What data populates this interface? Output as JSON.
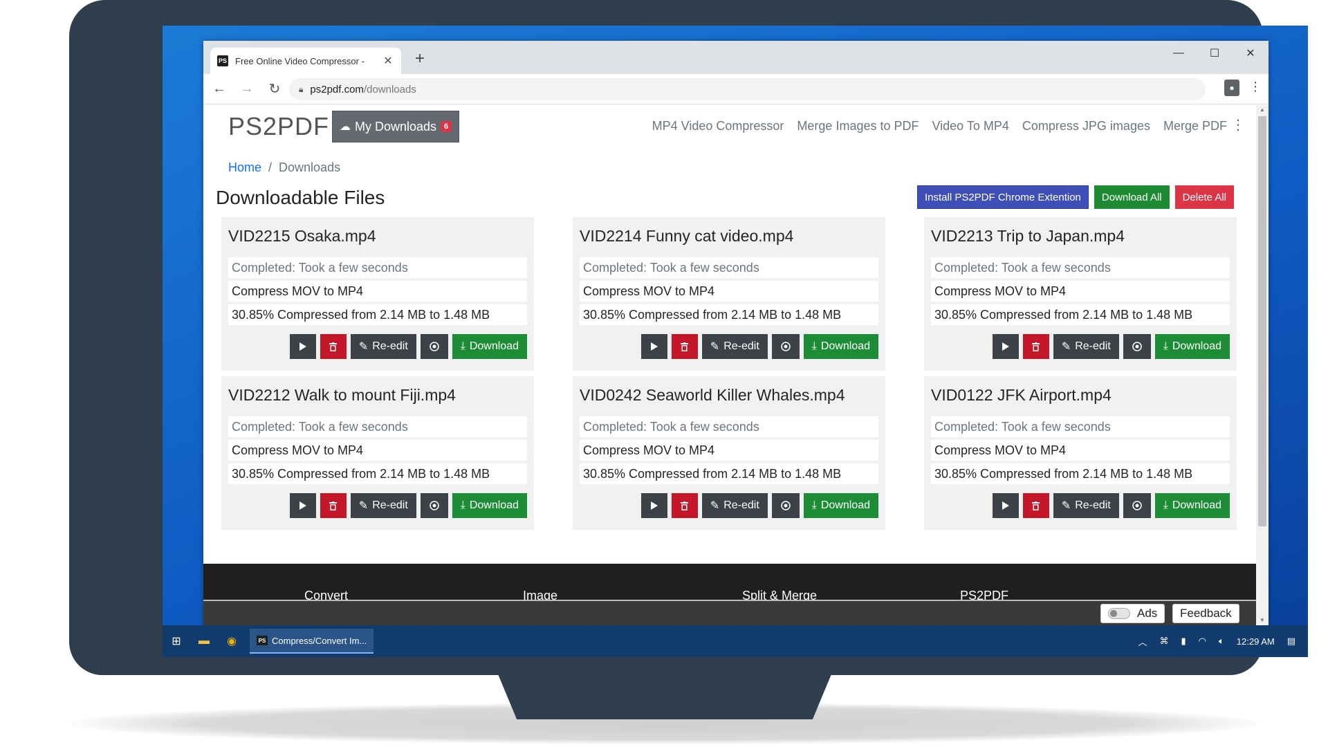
{
  "browser": {
    "tab_title": "Free Online Video Compressor - ",
    "favicon_text": "PS",
    "new_tab": "+",
    "url_host": "ps2pdf.com",
    "url_path": "/downloads"
  },
  "site": {
    "logo": "PS2PDF",
    "my_downloads": "My Downloads",
    "downloads_count": "6",
    "nav_links": [
      "MP4 Video Compressor",
      "Merge Images to PDF",
      "Video To MP4",
      "Compress JPG images",
      "Merge PDF"
    ]
  },
  "breadcrumb": {
    "home": "Home",
    "separator": "/",
    "current": "Downloads"
  },
  "heading": "Downloadable Files",
  "actions": {
    "install": "Install PS2PDF Chrome Extention",
    "download_all": "Download All",
    "delete_all": "Delete All"
  },
  "card_buttons": {
    "reedit": "Re-edit",
    "download": "Download"
  },
  "files": [
    {
      "name": "VID2215 Osaka.mp4",
      "status": "Completed: Took a few seconds",
      "task": "Compress MOV to MP4",
      "result": "30.85% Compressed from 2.14 MB to 1.48 MB"
    },
    {
      "name": "VID2214 Funny cat video.mp4",
      "status": "Completed: Took a few seconds",
      "task": "Compress MOV to MP4",
      "result": "30.85% Compressed from 2.14 MB to 1.48 MB"
    },
    {
      "name": "VID2213 Trip to Japan.mp4",
      "status": "Completed: Took a few seconds",
      "task": "Compress MOV to MP4",
      "result": "30.85% Compressed from 2.14 MB to 1.48 MB"
    },
    {
      "name": "VID2212 Walk to mount Fiji.mp4",
      "status": "Completed: Took a few seconds",
      "task": "Compress MOV to MP4",
      "result": "30.85% Compressed from 2.14 MB to 1.48 MB"
    },
    {
      "name": "VID0242 Seaworld Killer Whales.mp4",
      "status": "Completed: Took a few seconds",
      "task": "Compress MOV to MP4",
      "result": "30.85% Compressed from 2.14 MB to 1.48 MB"
    },
    {
      "name": "VID0122 JFK Airport.mp4",
      "status": "Completed: Took a few seconds",
      "task": "Compress MOV to MP4",
      "result": "30.85% Compressed from 2.14 MB to 1.48 MB"
    }
  ],
  "footer": {
    "links": [
      "Convert",
      "Image",
      "Split & Merge",
      "PS2PDF"
    ],
    "ads_label": "Ads",
    "feedback_label": "Feedback"
  },
  "taskbar": {
    "task_label": "Compress/Convert Im...",
    "task_icon_text": "PS",
    "clock": "12:29 AM"
  },
  "colors": {
    "primary_link": "#0d6efd",
    "install_button": "#3f4fb8",
    "success": "#1e8a34",
    "danger": "#dc3545",
    "dark_button": "#3d4248"
  }
}
